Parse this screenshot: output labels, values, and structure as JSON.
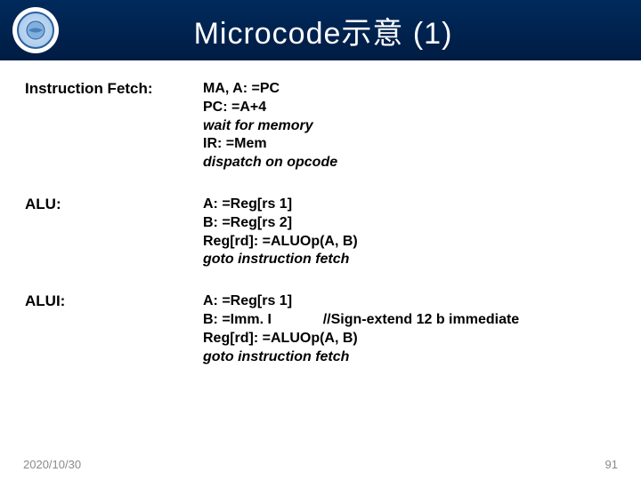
{
  "header": {
    "title": "Microcode示意 (1)",
    "logo_alt": "university-seal"
  },
  "sections": [
    {
      "label": "Instruction Fetch:",
      "lines": [
        {
          "text": "MA, A: =PC",
          "italic": false
        },
        {
          "text": "PC: =A+4",
          "italic": false
        },
        {
          "text": "wait for memory",
          "italic": true
        },
        {
          "text": "IR: =Mem",
          "italic": false
        },
        {
          "text": "dispatch on opcode",
          "italic": true
        }
      ]
    },
    {
      "label": "ALU:",
      "lines": [
        {
          "text": "A: =Reg[rs 1]",
          "italic": false
        },
        {
          "text": "B: =Reg[rs 2]",
          "italic": false
        },
        {
          "text": "Reg[rd]: =ALUOp(A, B)",
          "italic": false
        },
        {
          "text": "goto instruction fetch",
          "italic": true
        }
      ]
    },
    {
      "label": "ALUI:",
      "lines": [
        {
          "text": "A: =Reg[rs 1]",
          "italic": false
        },
        {
          "text": "B: =Imm. I             //Sign-extend 12 b immediate",
          "italic": false
        },
        {
          "text": "Reg[rd]: =ALUOp(A, B)",
          "italic": false
        },
        {
          "text": "goto instruction fetch",
          "italic": true
        }
      ]
    }
  ],
  "footer": {
    "date": "2020/10/30",
    "page": "91"
  }
}
